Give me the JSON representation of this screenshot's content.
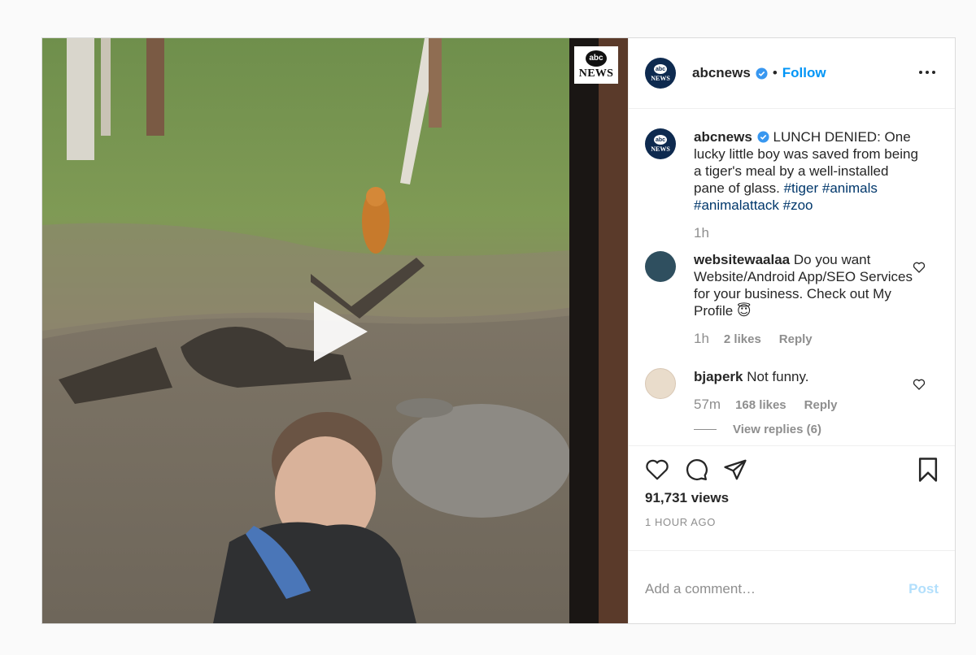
{
  "post": {
    "account": {
      "username": "abcnews",
      "avatar_text_top": "abc",
      "avatar_text_bottom": "NEWS",
      "verified": true,
      "follow_label": "Follow",
      "separator": "•"
    },
    "media": {
      "watermark_top": "abc",
      "watermark_bottom": "NEWS",
      "type": "video"
    },
    "caption": {
      "username": "abcnews",
      "text": "LUNCH DENIED: One lucky little boy was saved from being a tiger's meal by a well-installed pane of glass.",
      "hashtags": [
        "#tiger",
        "#animals",
        "#animalattack",
        "#zoo"
      ],
      "time": "1h"
    },
    "comments": [
      {
        "username": "websitewaalaa",
        "text": "Do you want Website/Android App/SEO Services for your business. Check out My Profile 😇",
        "time": "1h",
        "likes": "2 likes",
        "reply_label": "Reply"
      },
      {
        "username": "bjaperk",
        "text": "Not funny.",
        "time": "57m",
        "likes": "168 likes",
        "reply_label": "Reply",
        "view_replies": "View replies (6)"
      }
    ],
    "stats": {
      "views": "91,731 views",
      "posted_ago": "1 HOUR AGO"
    },
    "add_comment": {
      "placeholder": "Add a comment…",
      "post_label": "Post"
    }
  },
  "colors": {
    "link_blue": "#0095f6",
    "hashtag": "#00376b",
    "muted": "#8e8e8e",
    "post_disabled": "#b2dffc"
  }
}
